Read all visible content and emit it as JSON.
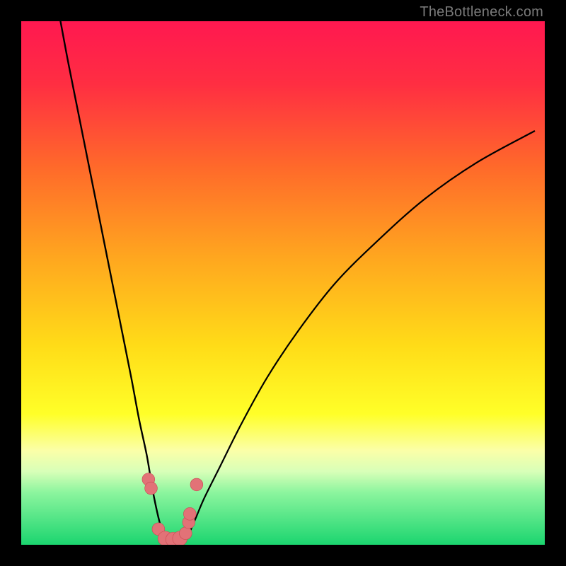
{
  "watermark": "TheBottleneck.com",
  "colors": {
    "frame": "#000000",
    "curve": "#000000",
    "marker_fill": "#e27277",
    "marker_stroke": "#c84a52"
  },
  "chart_data": {
    "type": "line",
    "title": "",
    "xlabel": "",
    "ylabel": "",
    "xlim": [
      0,
      100
    ],
    "ylim": [
      0,
      100
    ],
    "gradient_stops": [
      {
        "offset": 0,
        "color": "#ff1850"
      },
      {
        "offset": 12,
        "color": "#ff2e42"
      },
      {
        "offset": 28,
        "color": "#ff6a2a"
      },
      {
        "offset": 45,
        "color": "#ffa61f"
      },
      {
        "offset": 62,
        "color": "#ffdc18"
      },
      {
        "offset": 75,
        "color": "#ffff28"
      },
      {
        "offset": 82,
        "color": "#fbffa8"
      },
      {
        "offset": 86,
        "color": "#d8ffb8"
      },
      {
        "offset": 90,
        "color": "#8cf59e"
      },
      {
        "offset": 100,
        "color": "#1bd56f"
      }
    ],
    "series": [
      {
        "name": "left-curve",
        "x": [
          7.5,
          9,
          11,
          13,
          15,
          17,
          19,
          21,
          22.5,
          24,
          25,
          25.8,
          26.5,
          27,
          27.3
        ],
        "y": [
          100,
          92,
          82,
          72,
          62,
          52,
          42,
          32,
          24,
          17,
          11,
          7,
          4,
          2,
          0.5
        ]
      },
      {
        "name": "right-curve",
        "x": [
          31.2,
          32,
          33.3,
          35,
          38,
          42,
          47,
          53,
          60,
          68,
          77,
          87,
          98
        ],
        "y": [
          0.5,
          2,
          5,
          9,
          15,
          23,
          32,
          41,
          50,
          58,
          66,
          73,
          79
        ]
      }
    ],
    "markers": [
      {
        "x": 24.3,
        "y": 12.5,
        "r": 1.2
      },
      {
        "x": 24.8,
        "y": 10.8,
        "r": 1.2
      },
      {
        "x": 26.2,
        "y": 3.0,
        "r": 1.2
      },
      {
        "x": 27.5,
        "y": 1.2,
        "r": 1.4
      },
      {
        "x": 29.0,
        "y": 1.0,
        "r": 1.4
      },
      {
        "x": 30.3,
        "y": 1.2,
        "r": 1.4
      },
      {
        "x": 31.4,
        "y": 2.2,
        "r": 1.2
      },
      {
        "x": 32.0,
        "y": 4.3,
        "r": 1.2
      },
      {
        "x": 32.2,
        "y": 5.9,
        "r": 1.2
      },
      {
        "x": 33.5,
        "y": 11.5,
        "r": 1.2
      }
    ]
  }
}
